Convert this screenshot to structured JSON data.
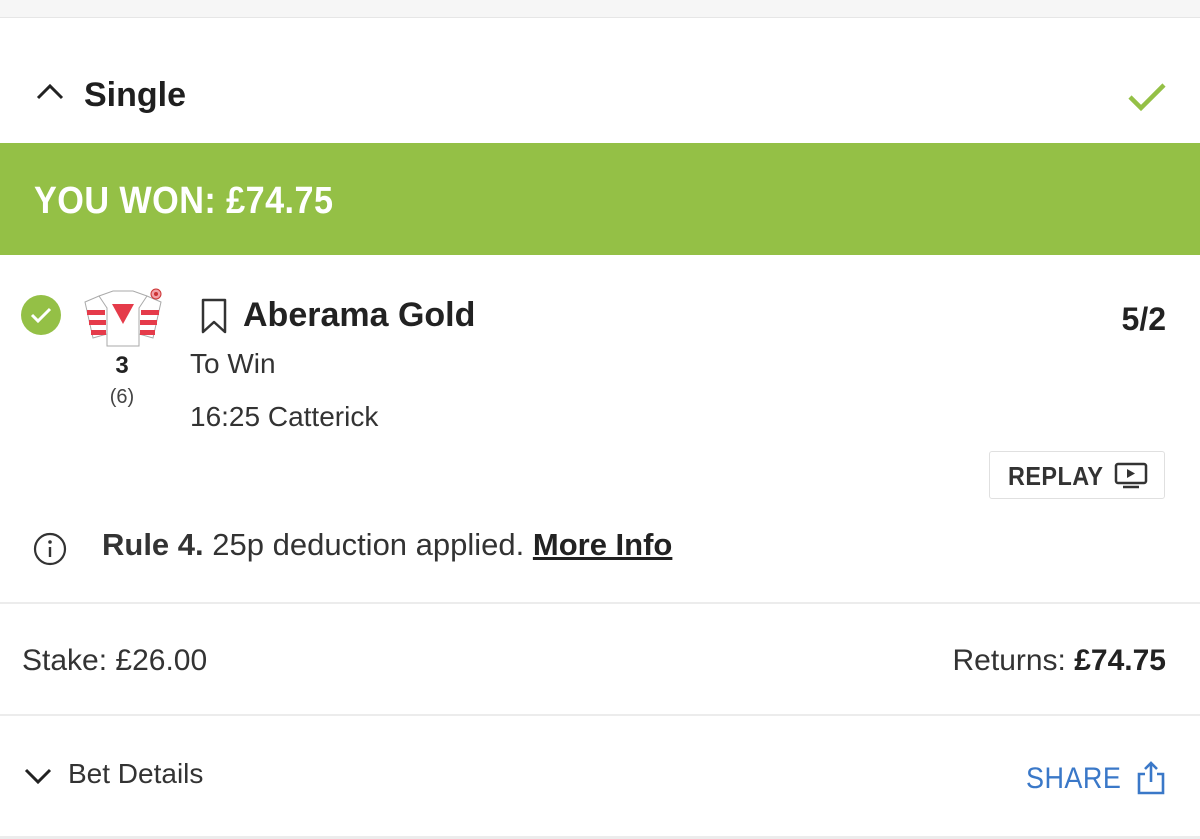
{
  "bet": {
    "type": "Single",
    "won_banner": "YOU WON: £74.75",
    "status_color": "#94c046"
  },
  "selection": {
    "runner_number": "3",
    "draw": "(6)",
    "horse_name": "Aberama Gold",
    "odds": "5/2",
    "market": "To Win",
    "race": "16:25 Catterick",
    "replay_label": "REPLAY"
  },
  "rule4": {
    "bold": "Rule 4.",
    "text": " 25p deduction applied. ",
    "link": "More Info"
  },
  "totals": {
    "stake": "Stake: £26.00",
    "returns_label": "Returns: ",
    "returns_value": "£74.75"
  },
  "footer": {
    "details_label": "Bet Details",
    "share_label": "SHARE",
    "share_color": "#3a78c8"
  }
}
